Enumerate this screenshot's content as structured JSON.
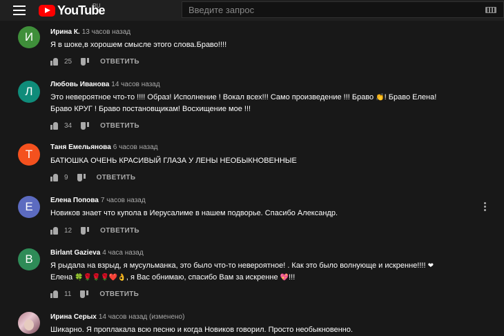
{
  "header": {
    "logo_text": "YouTube",
    "region": "RU",
    "search_placeholder": "Введите запрос",
    "logo_color": "#ff0000"
  },
  "reply_label": "ОТВЕТИТЬ",
  "comments": [
    {
      "author": "Ирина К.",
      "time": "13 часов назад",
      "initial": "И",
      "avatar_color": "#3f8f3a",
      "text": "Я в шоке,в хорошем смысле этого слова.Браво!!!!",
      "likes": "25"
    },
    {
      "author": "Любовь Иванова",
      "time": "14 часов назад",
      "initial": "Л",
      "avatar_color": "#0f8c7a",
      "text1": "Это невероятное что-то !!!! Образ! Исполнение ! Вокал всех!!! Само произведение !!! Браво ",
      "emoji1": "👏",
      "text1b": "! Браво Елена!",
      "text2": "Браво  КРУГ ! Браво постановщикам! Восхищение мое !!!",
      "likes": "34"
    },
    {
      "author": "Таня Емельянова",
      "time": "6 часов назад",
      "initial": "Т",
      "avatar_color": "#f4511e",
      "text": "БАТЮШКА ОЧЕНЬ КРАСИВЫЙ ГЛАЗА У ЛЕНЫ НЕОБЫКНОВЕННЫЕ",
      "likes": "9"
    },
    {
      "author": "Елена Попова",
      "time": "7 часов назад",
      "initial": "Е",
      "avatar_color": "#5c6bc0",
      "text": "Новиков знает что купола в Иерусалиме в нашем подворье. Спасибо Александр.",
      "likes": "12"
    },
    {
      "author": "Birlant Gazieva",
      "time": "4 часа назад",
      "initial": "B",
      "avatar_color": "#2e8b57",
      "text1": "Я рыдала на взрыд, я мусульманка,  это было что-то невероятное! . Как это было волнующе и искренне!!!! ",
      "emoji1": "❤",
      "text2a": "Елена ",
      "emoji2": "🍀🌹🌹🌹❤️👌",
      "text2b": ", я Вас обнимаю, спасибо Вам за искренне ",
      "emoji3": "💖",
      "text2c": "!!!",
      "likes": "11"
    },
    {
      "author": "Ирина Серых",
      "time": "14 часов назад (изменено)",
      "text": "Шикарно. Я проплакала всю песню и когда Новиков говорил. Просто необыкновенно."
    }
  ]
}
